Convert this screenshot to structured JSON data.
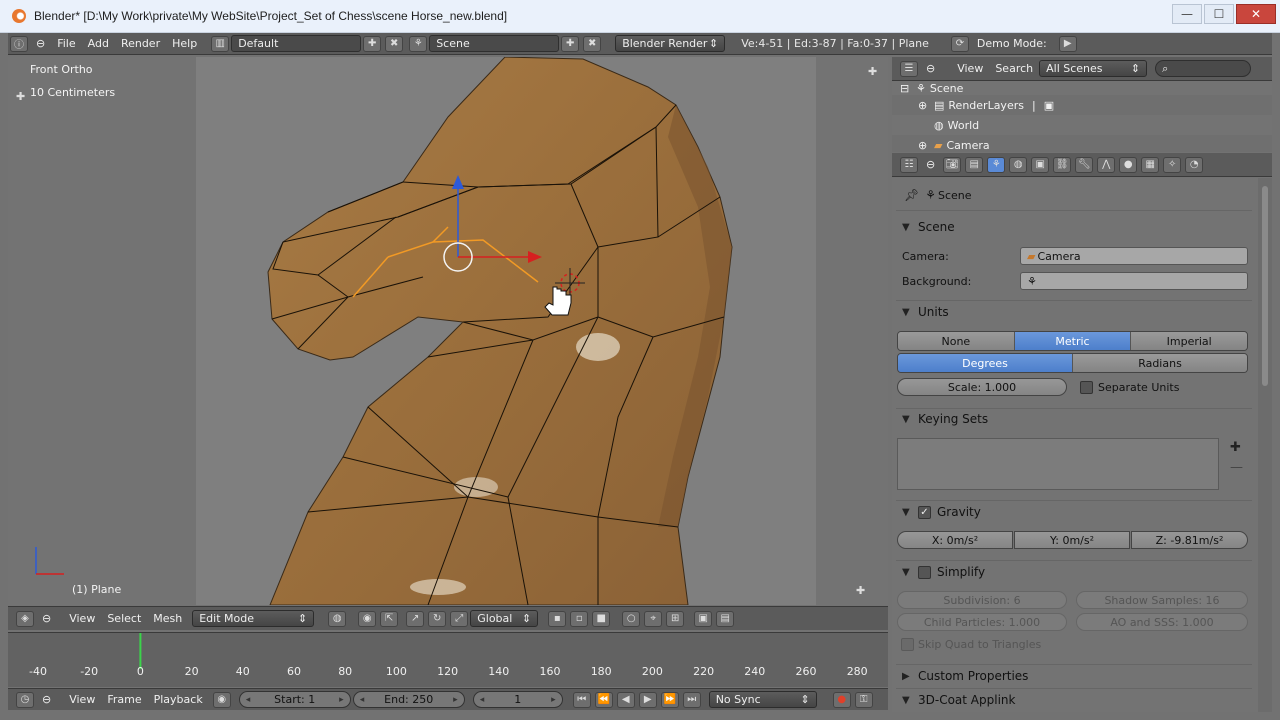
{
  "window": {
    "title": "Blender* [D:\\My Work\\private\\My WebSite\\Project_Set of Chess\\scene Horse_new.blend]",
    "minimize": "—",
    "maximize": "☐",
    "close": "✕"
  },
  "info": {
    "menus": [
      "File",
      "Add",
      "Render",
      "Help"
    ],
    "screen_layout": "Default",
    "scene": "Scene",
    "engine": "Blender Render",
    "stats": "Ve:4-51 | Ed:3-87 | Fa:0-37 | Plane",
    "demo_mode": "Demo Mode:"
  },
  "viewport": {
    "view_name": "Front Ortho",
    "scale": "10 Centimeters",
    "object_label": "(1) Plane"
  },
  "viewport_header": {
    "menus": [
      "View",
      "Select",
      "Mesh"
    ],
    "mode": "Edit Mode",
    "orientation": "Global"
  },
  "timeline": {
    "ticks": [
      "-40",
      "-20",
      "0",
      "20",
      "40",
      "60",
      "80",
      "100",
      "120",
      "140",
      "160",
      "180",
      "200",
      "220",
      "240",
      "260",
      "280"
    ],
    "current_frame_fraction": 0.0,
    "menus": [
      "View",
      "Frame",
      "Playback"
    ],
    "start": "Start: 1",
    "end": "End: 250",
    "frame": "1",
    "sync": "No Sync"
  },
  "outliner": {
    "menus": [
      "View",
      "Search"
    ],
    "display": "All Scenes",
    "items": [
      "Scene",
      "RenderLayers",
      "World",
      "Camera"
    ]
  },
  "properties": {
    "context": "Scene",
    "scene_panel": {
      "title": "Scene",
      "camera_label": "Camera:",
      "camera_value": "Camera",
      "background_label": "Background:"
    },
    "units_panel": {
      "title": "Units",
      "systems": [
        "None",
        "Metric",
        "Imperial"
      ],
      "active_system": "Metric",
      "rotation": [
        "Degrees",
        "Radians"
      ],
      "active_rotation": "Degrees",
      "scale": "Scale: 1.000",
      "separate_units": "Separate Units"
    },
    "keying_panel": {
      "title": "Keying Sets"
    },
    "gravity_panel": {
      "title": "Gravity",
      "x": "X: 0m/s²",
      "y": "Y: 0m/s²",
      "z": "Z: -9.81m/s²"
    },
    "simplify_panel": {
      "title": "Simplify",
      "subdivision": "Subdivision: 6",
      "shadow_samples": "Shadow Samples: 16",
      "child_particles": "Child Particles: 1.000",
      "ao_sss": "AO and SSS: 1.000",
      "skip_quad": "Skip Quad to Triangles"
    },
    "custom_properties": "Custom Properties",
    "coat_applink": "3D-Coat Applink"
  },
  "colors": {
    "accent_blue": "#5a8ad6",
    "timeline_cursor": "#3bd44a",
    "brand_orange": "#e8772e"
  }
}
